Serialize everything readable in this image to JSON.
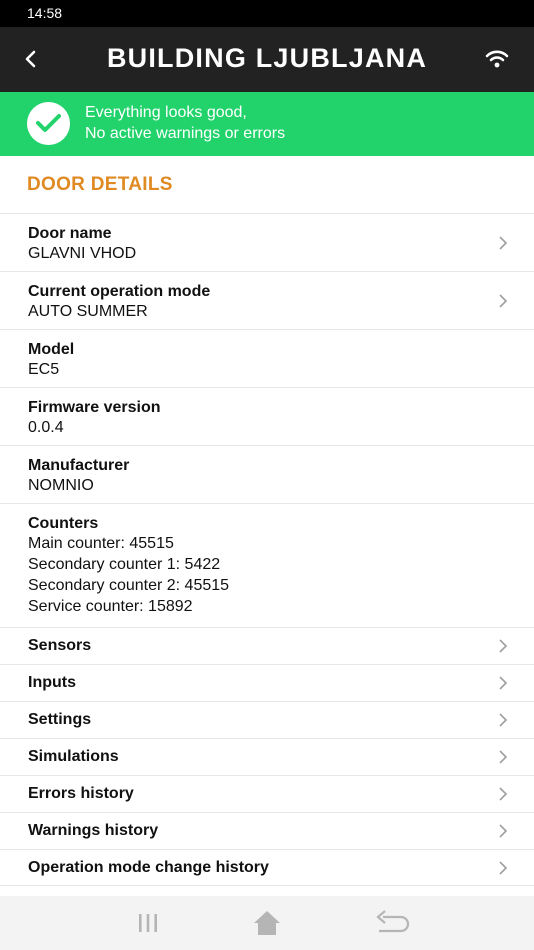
{
  "status_bar": {
    "time": "14:58"
  },
  "header": {
    "title": "BUILDING LJUBLJANA"
  },
  "status_banner": {
    "line1": "Everything looks good,",
    "line2": "No active warnings or errors"
  },
  "section": {
    "title": "DOOR DETAILS"
  },
  "details": [
    {
      "label": "Door name",
      "value": "GLAVNI VHOD"
    },
    {
      "label": "Current operation mode",
      "value": "AUTO SUMMER"
    },
    {
      "label": "Model",
      "value": "EC5"
    },
    {
      "label": "Firmware version",
      "value": "0.0.4"
    },
    {
      "label": "Manufacturer",
      "value": "NOMNIO"
    }
  ],
  "counters": {
    "label": "Counters",
    "lines": [
      "Main counter: 45515",
      "Secondary counter 1: 5422",
      "Secondary counter 2: 45515",
      "Service counter: 15892"
    ]
  },
  "menu": [
    "Sensors",
    "Inputs",
    "Settings",
    "Simulations",
    "Errors history",
    "Warnings history",
    "Operation mode change history"
  ],
  "colors": {
    "header_bg": "#222222",
    "status_ok": "#22d36c",
    "section_accent": "#e08a24"
  },
  "icons": [
    "back-icon",
    "wifi-icon",
    "check-icon",
    "chevron-right-icon",
    "recent-apps-icon",
    "home-icon",
    "back-nav-icon"
  ]
}
